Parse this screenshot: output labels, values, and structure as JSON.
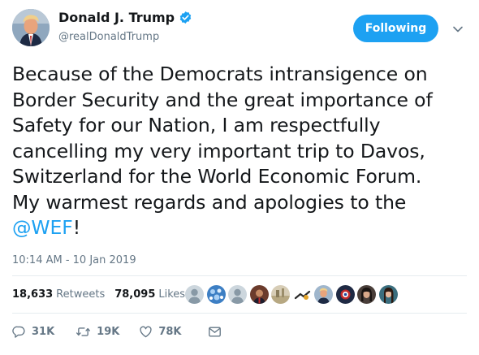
{
  "author": {
    "display_name": "Donald J. Trump",
    "handle": "@realDonaldTrump",
    "verified": true
  },
  "follow_button": {
    "label": "Following"
  },
  "tweet": {
    "lines": [
      "Because of the Democrats intransigence on",
      "Border Security and the great importance of",
      "Safety for our Nation, I am respectfully",
      "cancelling my very important trip to Davos,",
      "Switzerland for the World Economic Forum.",
      "My warmest regards and apologies to the"
    ],
    "mention": "@WEF",
    "tail": "!"
  },
  "timestamp": "10:14 AM - 10 Jan 2019",
  "stats": {
    "retweets_count": "18,633",
    "retweets_label": "Retweets",
    "likes_count": "78,095",
    "likes_label": "Likes"
  },
  "actions": {
    "reply_count": "31K",
    "retweet_count": "19K",
    "like_count": "78K"
  },
  "colors": {
    "accent": "#1da1f2",
    "muted": "#657786",
    "text": "#14171a",
    "divider": "#e6ecf0"
  },
  "icons": [
    "verified-badge-icon",
    "chevron-down-icon",
    "reply-icon",
    "retweet-icon",
    "like-heart-icon",
    "direct-message-icon"
  ]
}
